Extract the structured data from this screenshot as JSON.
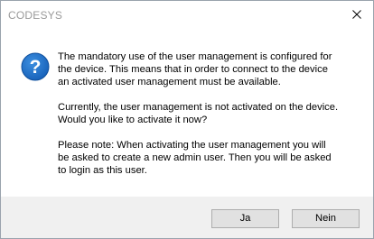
{
  "window": {
    "title": "CODESYS",
    "close_icon": "close-icon"
  },
  "icon": "question-icon",
  "icon_glyph": "?",
  "message": {
    "paragraph1": "The mandatory use of the user management is configured for\nthe device. This means that in order to connect to the device\nan activated user management must be available.",
    "paragraph2": "Currently, the user management is not activated on the device.\nWould you like to activate it now?",
    "paragraph3": "Please note: When activating the user management you will\nbe asked to create a new admin user. Then you will be asked\nto login as this user."
  },
  "buttons": {
    "yes_label": "Ja",
    "no_label": "Nein"
  },
  "colors": {
    "icon_blue": "#1a6fc9",
    "footer_bg": "#f0f0f0",
    "button_bg": "#e1e1e1",
    "button_border": "#adadad"
  }
}
